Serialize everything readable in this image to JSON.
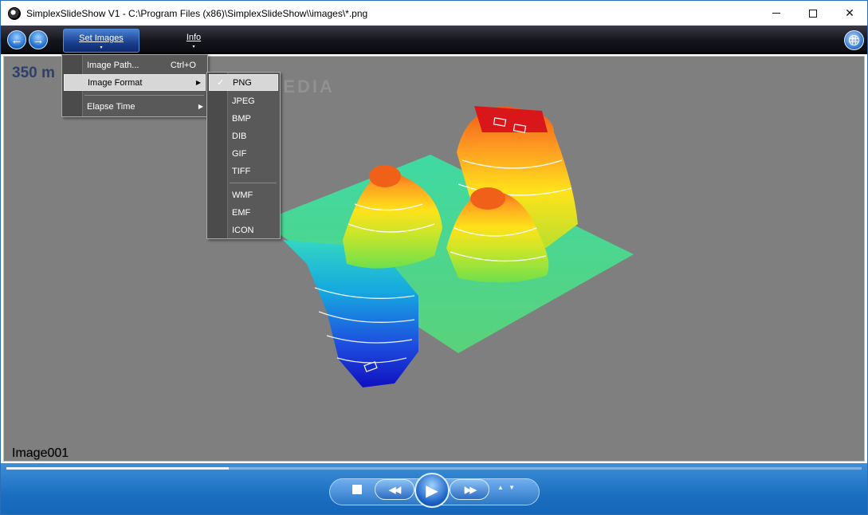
{
  "window": {
    "title": "SimplexSlideShow V1 - C:\\Program Files (x86)\\SimplexSlideShow\\\\images\\*.png",
    "minimize_icon": "minimize-icon",
    "maximize_icon": "maximize-icon",
    "close_label": "✕"
  },
  "toolbar": {
    "back_icon": "arrow-left-icon",
    "back_glyph": "←",
    "forward_icon": "arrow-right-icon",
    "forward_glyph": "→",
    "set_images_label": "Set Images",
    "info_label": "Info",
    "menu_arrow": "▾",
    "globe_icon": "globe-icon"
  },
  "viewer": {
    "top_overlay": "350 m",
    "image_caption": "Image001",
    "background": "#7f7f7f"
  },
  "set_images_menu": {
    "items": [
      {
        "label": "Image Path...",
        "shortcut": "Ctrl+O",
        "has_submenu": false,
        "highlighted": false
      },
      {
        "label": "Image Format",
        "shortcut": "",
        "has_submenu": true,
        "highlighted": true
      },
      {
        "label": "Elapse Time",
        "shortcut": "",
        "has_submenu": true,
        "highlighted": false
      }
    ],
    "submenu_arrow": "▶"
  },
  "image_format_submenu": {
    "check_mark": "✓",
    "items": [
      {
        "label": "PNG",
        "checked": true
      },
      {
        "label": "JPEG",
        "checked": false
      },
      {
        "label": "BMP",
        "checked": false
      },
      {
        "label": "DIB",
        "checked": false
      },
      {
        "label": "GIF",
        "checked": false
      },
      {
        "label": "TIFF",
        "checked": false
      },
      {
        "label": "WMF",
        "checked": false
      },
      {
        "label": "EMF",
        "checked": false
      },
      {
        "label": "ICON",
        "checked": false
      }
    ]
  },
  "playback": {
    "progress_fraction": 0.26,
    "stop_icon": "stop-icon",
    "seek_back_glyph": "◀◀I",
    "play_glyph": "▶",
    "seek_forward_glyph": "I▶▶",
    "volume_glyph": "▲ ▼"
  },
  "colors": {
    "accent": "#1a6fc0",
    "toolbar": "#15151c",
    "menu_bg": "#595959"
  }
}
